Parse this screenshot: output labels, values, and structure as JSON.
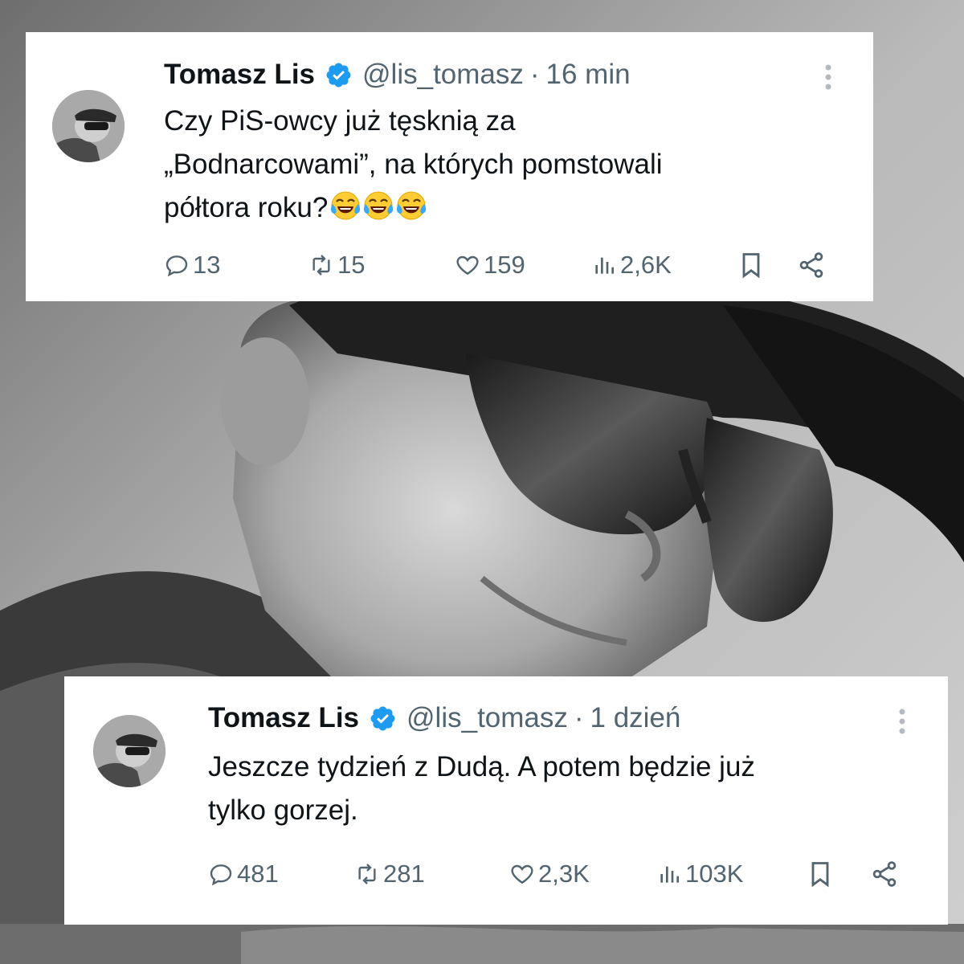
{
  "tweets": [
    {
      "author": "Tomasz Lis",
      "handle": "@lis_tomasz",
      "separator": "·",
      "time": "16 min",
      "text": "Czy PiS-owcy już tęsknią za\n„Bodnarcowami”, na których pomstowali\npółtora roku?",
      "emoji": [
        "face-with-tears-of-joy-icon",
        "face-with-tears-of-joy-icon",
        "face-with-tears-of-joy-icon"
      ],
      "stats": {
        "replies": "13",
        "reposts": "15",
        "likes": "159",
        "views": "2,6K"
      }
    },
    {
      "author": "Tomasz Lis",
      "handle": "@lis_tomasz",
      "separator": "·",
      "time": "1 dzień",
      "text": "Jeszcze tydzień z Dudą. A potem będzie już\ntylko gorzej.",
      "emoji": [],
      "stats": {
        "replies": "481",
        "reposts": "281",
        "likes": "2,3K",
        "views": "103K"
      }
    }
  ],
  "colors": {
    "text_primary": "#0f1419",
    "text_secondary": "#536471",
    "verified": "#1d9bf0",
    "card_bg": "#ffffff"
  },
  "icons": {
    "verified": "verified-badge-icon",
    "more": "more-vertical-icon",
    "reply": "reply-bubble-icon",
    "repost": "repost-icon",
    "like": "heart-icon",
    "views": "views-bar-chart-icon",
    "bookmark": "bookmark-icon",
    "share": "share-icon"
  }
}
